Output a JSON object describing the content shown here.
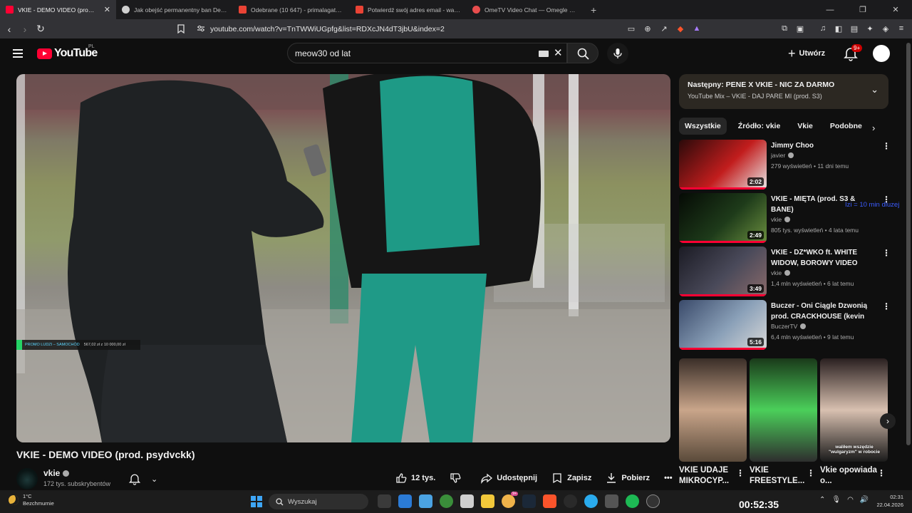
{
  "browser": {
    "tabs": [
      {
        "title": "VKIE - DEMO VIDEO (prod. psydvckk)",
        "active": true,
        "favicon_color": "#ff0033"
      },
      {
        "title": "Jak obejść permanentny ban Device ID",
        "active": false,
        "favicon_color": "#cfcfcf"
      },
      {
        "title": "Odebrane (10 647) - primalagate@gmail",
        "active": false,
        "favicon_color": "#ea4335"
      },
      {
        "title": "Potwierdź swój adres email - walexander",
        "active": false,
        "favicon_color": "#ea4335"
      },
      {
        "title": "OmeTV Video Chat — Omegle Random",
        "active": false,
        "favicon_color": "#e84d4d"
      }
    ],
    "new_tab_icon": "plus-icon",
    "url": "youtube.com/watch?v=TnTWWiUGpfg&list=RDXcJN4dT3jbU&index=2"
  },
  "youtube": {
    "logo_text": "YouTube",
    "country_code": "PL",
    "search_value": "meow30 od lat",
    "create_label": "Utwórz",
    "notifications_badge": "9+"
  },
  "video": {
    "overlay_text_left": "PROMO LUDZI – SAMOCHÓD",
    "overlay_text_right": "567,02 zł z 10 000,00 zł",
    "title": "VKIE - DEMO VIDEO (prod. psydvckk)",
    "channel": "vkie",
    "subscribers": "172 tys. subskrybentów",
    "likes": "12 tys.",
    "share_label": "Udostępnij",
    "save_label": "Zapisz",
    "download_label": "Pobierz"
  },
  "playlist": {
    "next_label": "Następny: PENE X VKIE - NIC ZA DARMO",
    "mix_label": "YouTube Mix – VKIE - DAJ PARE MI (prod. S3)"
  },
  "chips": [
    "Wszystkie",
    "Źródło: vkie",
    "Vkie",
    "Podobne"
  ],
  "recommendations": [
    {
      "title": "Jimmy Choo",
      "channel": "javier",
      "meta": "279 wyświetleń • 11 dni temu",
      "duration": "2:02",
      "progress": 1.0,
      "thumb": [
        "#2a0a0a",
        "#c21d1d",
        "#e8e8e8"
      ]
    },
    {
      "title": "VKIE - MIĘTA (prod. S3 & BANE)",
      "channel": "vkie",
      "meta": "805 tys. wyświetleń • 4 lata temu",
      "duration": "2:49",
      "progress": 1.0,
      "thumb": [
        "#050a05",
        "#1e3b1a",
        "#6b8f3f"
      ]
    },
    {
      "title": "VKIE - DZ*WKO ft. WHITE WIDOW, BOROWY VIDEO",
      "channel": "vkie",
      "meta": "1,4 mln wyświetleń • 6 lat temu",
      "duration": "3:49",
      "progress": 1.0,
      "thumb": [
        "#1b1b24",
        "#4a4a5a",
        "#8a6a6a"
      ]
    },
    {
      "title": "Buczer - Oni Ciągle Dzwonią prod. CRACKHOUSE (kevin ...",
      "channel": "BuczerTV",
      "meta": "6,4 mln wyświetleń • 9 lat temu",
      "duration": "5:16",
      "progress": 1.0,
      "thumb": [
        "#3a4a6a",
        "#8aa0b8",
        "#d8d8d8"
      ]
    }
  ],
  "floating_note": "Izi = 10 min dluzej",
  "shorts": [
    {
      "title": "VKIE UDAJE MIKROCYP...",
      "caption": "",
      "colors": [
        "#3a2e28",
        "#c9a58a",
        "#5a4a3a"
      ]
    },
    {
      "title": "VKIE FREESTYLE...",
      "caption": "",
      "colors": [
        "#1a3a1a",
        "#4bcf5a",
        "#2e2e2e"
      ]
    },
    {
      "title": "Vkie opowiada o...",
      "caption": "waliłem wszędzie \"wulgaryzm\" w robocie",
      "colors": [
        "#2a2020",
        "#d8c0b0",
        "#1a1a1a"
      ]
    }
  ],
  "stream_timer": "00:52:35",
  "taskbar": {
    "weather_temp": "1°C",
    "weather_desc": "Bezchmurnie",
    "search_label": "Wyszukaj",
    "time": "02:31",
    "date": "22.04.2026",
    "app_badge": "9+"
  },
  "colors": {
    "accent": "#ff0033",
    "background": "#0f0f0f",
    "playlist_bg": "#2c2822",
    "link_blue": "#3b5cff"
  }
}
